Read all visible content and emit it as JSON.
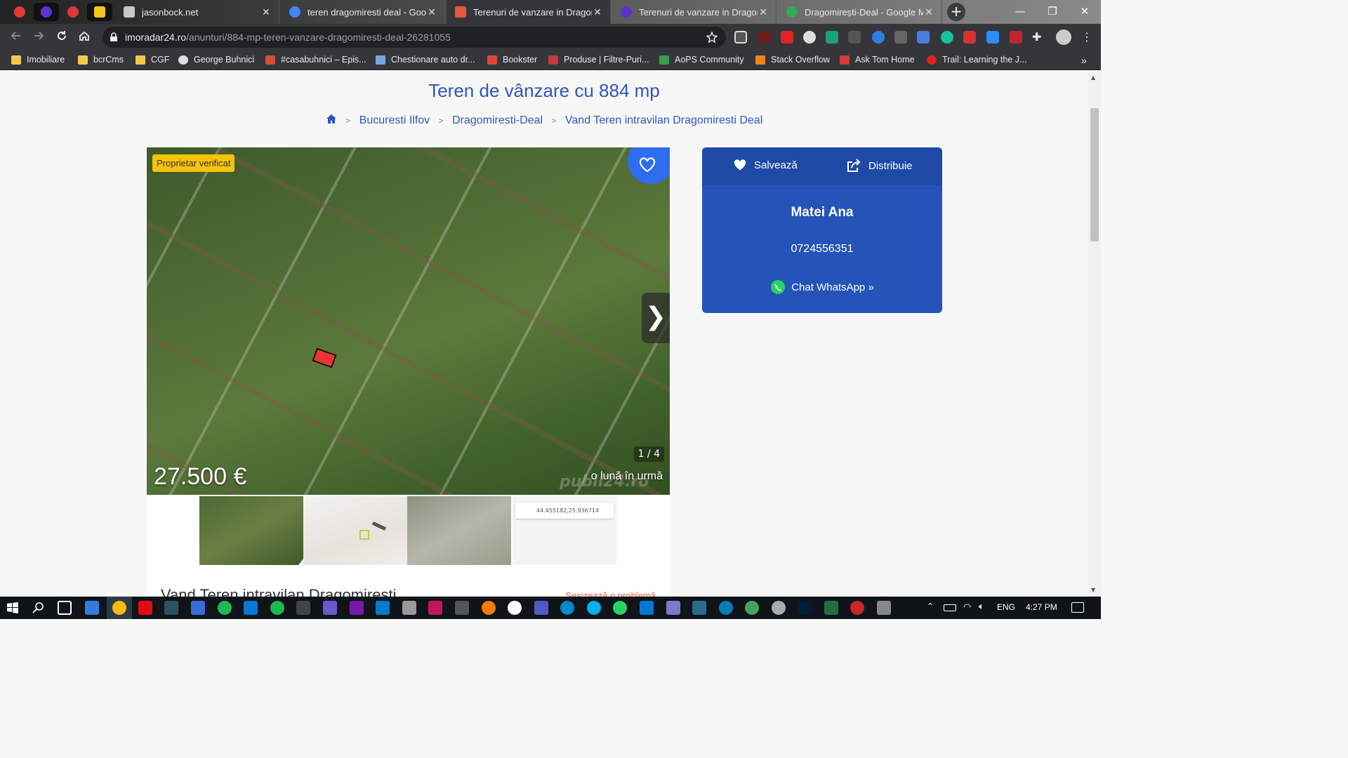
{
  "browser": {
    "pinned_tabs": [
      {
        "icon": "red-target-icon",
        "color": "#e53935"
      },
      {
        "icon": "purple-globe-icon",
        "color": "#5b34c9"
      },
      {
        "icon": "edge-icon",
        "color": "#d93a3a"
      },
      {
        "icon": "yellow-bolt-icon",
        "color": "#f5c518"
      }
    ],
    "tabs": [
      {
        "title": "jasonbock.net",
        "icon": "page-icon",
        "color": "#c9c9c9"
      },
      {
        "title": "teren dragomiresti deal - Google",
        "icon": "google-icon",
        "color": "#4285f4"
      },
      {
        "title": "Terenuri de vanzare in Dragomir",
        "icon": "publi24-icon",
        "color": "#e8563f"
      },
      {
        "title": "Terenuri de vanzare in Dragomir",
        "icon": "imoradar-icon",
        "color": "#5b34c9"
      },
      {
        "title": "Dragomirești-Deal - Google Ma",
        "icon": "maps-icon",
        "color": "#34a853"
      }
    ],
    "new_tab": "+",
    "window_controls": {
      "minimize": "—",
      "restore": "❐",
      "close": "✕"
    },
    "url_domain": "imoradar24.ro",
    "url_path": "/anunturi/884-mp-teren-vanzare-dragomiresti-deal-26281055",
    "bookmarks": [
      {
        "label": "Imobiliare",
        "icon": "folder-icon",
        "color": "#f2c94c"
      },
      {
        "label": "bcrCms",
        "icon": "folder-icon",
        "color": "#f2c94c"
      },
      {
        "label": "CGF",
        "icon": "folder-icon",
        "color": "#f2c94c"
      },
      {
        "label": "George Buhnici",
        "icon": "wordpress-icon",
        "color": "#dddddd"
      },
      {
        "label": "#casabuhnici – Epis...",
        "icon": "gb-icon",
        "color": "#d64b3c"
      },
      {
        "label": "Chestionare auto dr...",
        "icon": "car-icon",
        "color": "#7aa7d8"
      },
      {
        "label": "Bookster",
        "icon": "bookster-icon",
        "color": "#e0493a"
      },
      {
        "label": "Produse | Filtre-Puri...",
        "icon": "filter-icon",
        "color": "#c43a3a"
      },
      {
        "label": "AoPS Community",
        "icon": "aops-icon",
        "color": "#3a9b4a"
      },
      {
        "label": "Stack Overflow",
        "icon": "stackoverflow-icon",
        "color": "#f48024"
      },
      {
        "label": "Ask Tom Home",
        "icon": "asktom-icon",
        "color": "#d13b3b"
      },
      {
        "label": "Trail: Learning the J...",
        "icon": "oracle-icon",
        "color": "#e0221e"
      }
    ],
    "bookmarks_more": "»"
  },
  "listing": {
    "title": "Teren de vânzare cu 884 mp",
    "breadcrumbs": [
      "Bucuresti Ilfov",
      "Dragomiresti-Deal",
      "Vand Teren intravilan Dragomiresti Deal"
    ],
    "badge": "Proprietar verificat",
    "price": "27.500 €",
    "posted": "o lună în urmă",
    "counter": "1 / 4",
    "watermark": "publi24.ro",
    "next_arrow": "❯",
    "map_thumb_coords": "44.455182,25.936714",
    "description_title": "Vand Teren intravilan Dragomiresti",
    "report_link": "Sesizează o problemă"
  },
  "contact": {
    "save_label": "Salvează",
    "share_label": "Distribuie",
    "seller_name": "Matei Ana",
    "phone": "0724556351",
    "whatsapp_label": "Chat WhatsApp »",
    "accent": "#2454b8"
  },
  "taskbar": {
    "lang": "ENG",
    "time": "4:27 PM"
  }
}
